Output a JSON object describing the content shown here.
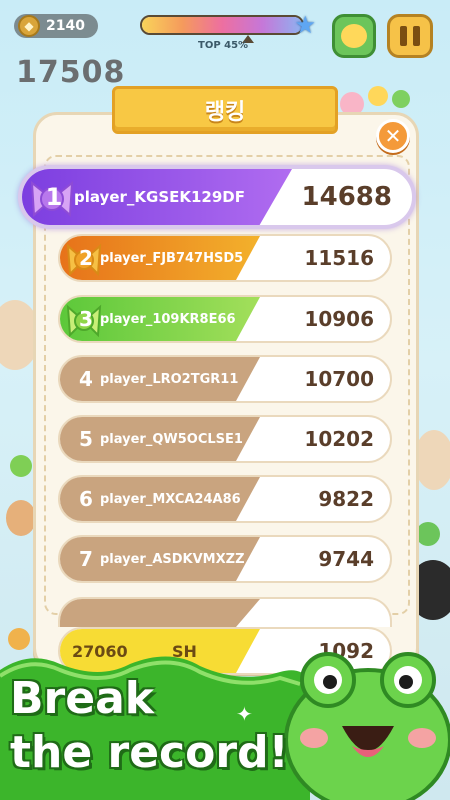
{
  "hud": {
    "coins": "2140",
    "progress_label": "TOP 45%",
    "progress_percent": 45,
    "score": "17508"
  },
  "panel": {
    "title": "랭킹",
    "close_label": "✕"
  },
  "ranking": [
    {
      "rank": "1",
      "name": "player_KGSEK129DF",
      "score": "14688"
    },
    {
      "rank": "2",
      "name": "player_FJB747HSD5",
      "score": "11516"
    },
    {
      "rank": "3",
      "name": "player_109KR8E66",
      "score": "10906"
    },
    {
      "rank": "4",
      "name": "player_LRO2TGR11",
      "score": "10700"
    },
    {
      "rank": "5",
      "name": "player_QW5OCLSE1",
      "score": "10202"
    },
    {
      "rank": "6",
      "name": "player_MXCA24A86",
      "score": "9822"
    },
    {
      "rank": "7",
      "name": "player_ASDKVMXZZ",
      "score": "9744"
    }
  ],
  "my_entry": {
    "rank": "27060",
    "name": "SH",
    "score": "1092"
  },
  "promo": {
    "line1": "Break",
    "line2": "the record!"
  },
  "colors": {
    "gold_band": "#f7dc34",
    "first_band": "#7c3ee0",
    "second_band": "#e7721a",
    "third_band": "#5cc83a",
    "other_band": "#c9a47f",
    "promo_green": "#3cb52b"
  }
}
